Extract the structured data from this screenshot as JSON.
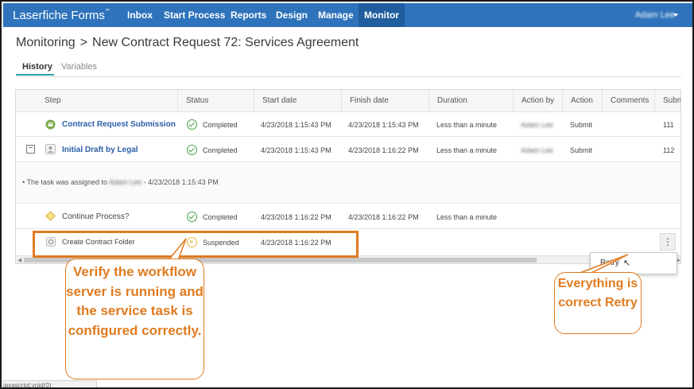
{
  "app": {
    "brand": "Laserfiche Forms",
    "brand_mark": "™",
    "nav": [
      "Inbox",
      "Start Process",
      "Reports",
      "Design",
      "Manage",
      "Monitor"
    ],
    "nav_active": "Monitor",
    "user_name": "Adam Lee"
  },
  "header": {
    "section": "Monitoring",
    "separator": ">",
    "title": "New Contract Request 72: Services Agreement"
  },
  "tabs": [
    "History",
    "Variables"
  ],
  "grid": {
    "columns": [
      "Step",
      "Status",
      "Start date",
      "Finish date",
      "Duration",
      "Action by",
      "Action",
      "Comments",
      "Subm"
    ],
    "rows": [
      {
        "step": "Contract Request Submission",
        "status": "Completed",
        "start": "4/23/2018 1:15:43 PM",
        "finish": "4/23/2018 1:15:43 PM",
        "duration": "Less than a minute",
        "action_by": "Adam Lee",
        "action": "Submit",
        "submission": "111"
      },
      {
        "step": "Initial Draft by Legal",
        "status": "Completed",
        "start": "4/23/2018 1:15:43 PM",
        "finish": "4/23/2018 1:16:22 PM",
        "duration": "Less than a minute",
        "action_by": "Adam Lee",
        "action": "Submit",
        "submission": "112"
      },
      {
        "step": "Continue Process?",
        "status": "Completed",
        "start": "4/23/2018 1:16:22 PM",
        "finish": "4/23/2018 1:16:22 PM",
        "duration": "Less than a minute",
        "action_by": "",
        "action": "",
        "submission": ""
      },
      {
        "step": "Create Contract Folder",
        "status": "Suspended",
        "start": "4/23/2018 1:16:22 PM",
        "finish": "",
        "duration": "",
        "action_by": "",
        "action": "",
        "submission": ""
      }
    ],
    "assignment_note": {
      "bullet": "•",
      "prefix": "The task was assigned to",
      "assignee": "Adam Lee",
      "suffix": "- 4/23/2018 1:15:43 PM"
    },
    "kebab": "⋮"
  },
  "menu": {
    "retry": "Retry"
  },
  "annotations": {
    "callout_left": "Verify the workflow server is running and the service task is configured correctly.",
    "callout_right": "Everything is correct Retry"
  },
  "status_bar": "javascript:void(0)",
  "colors": {
    "nav_bg": "#2e73bb",
    "accent_orange": "#e07b1f",
    "completed_green": "#44a04a",
    "suspended_yellow": "#e3b43a",
    "link_blue": "#2b5ea8"
  },
  "icons": [
    "form-submission-icon",
    "user-task-icon",
    "decision-diamond-icon",
    "service-task-gear-icon",
    "check-circle-icon",
    "pause-circle-icon",
    "collapse-minus-icon",
    "kebab-icon"
  ]
}
